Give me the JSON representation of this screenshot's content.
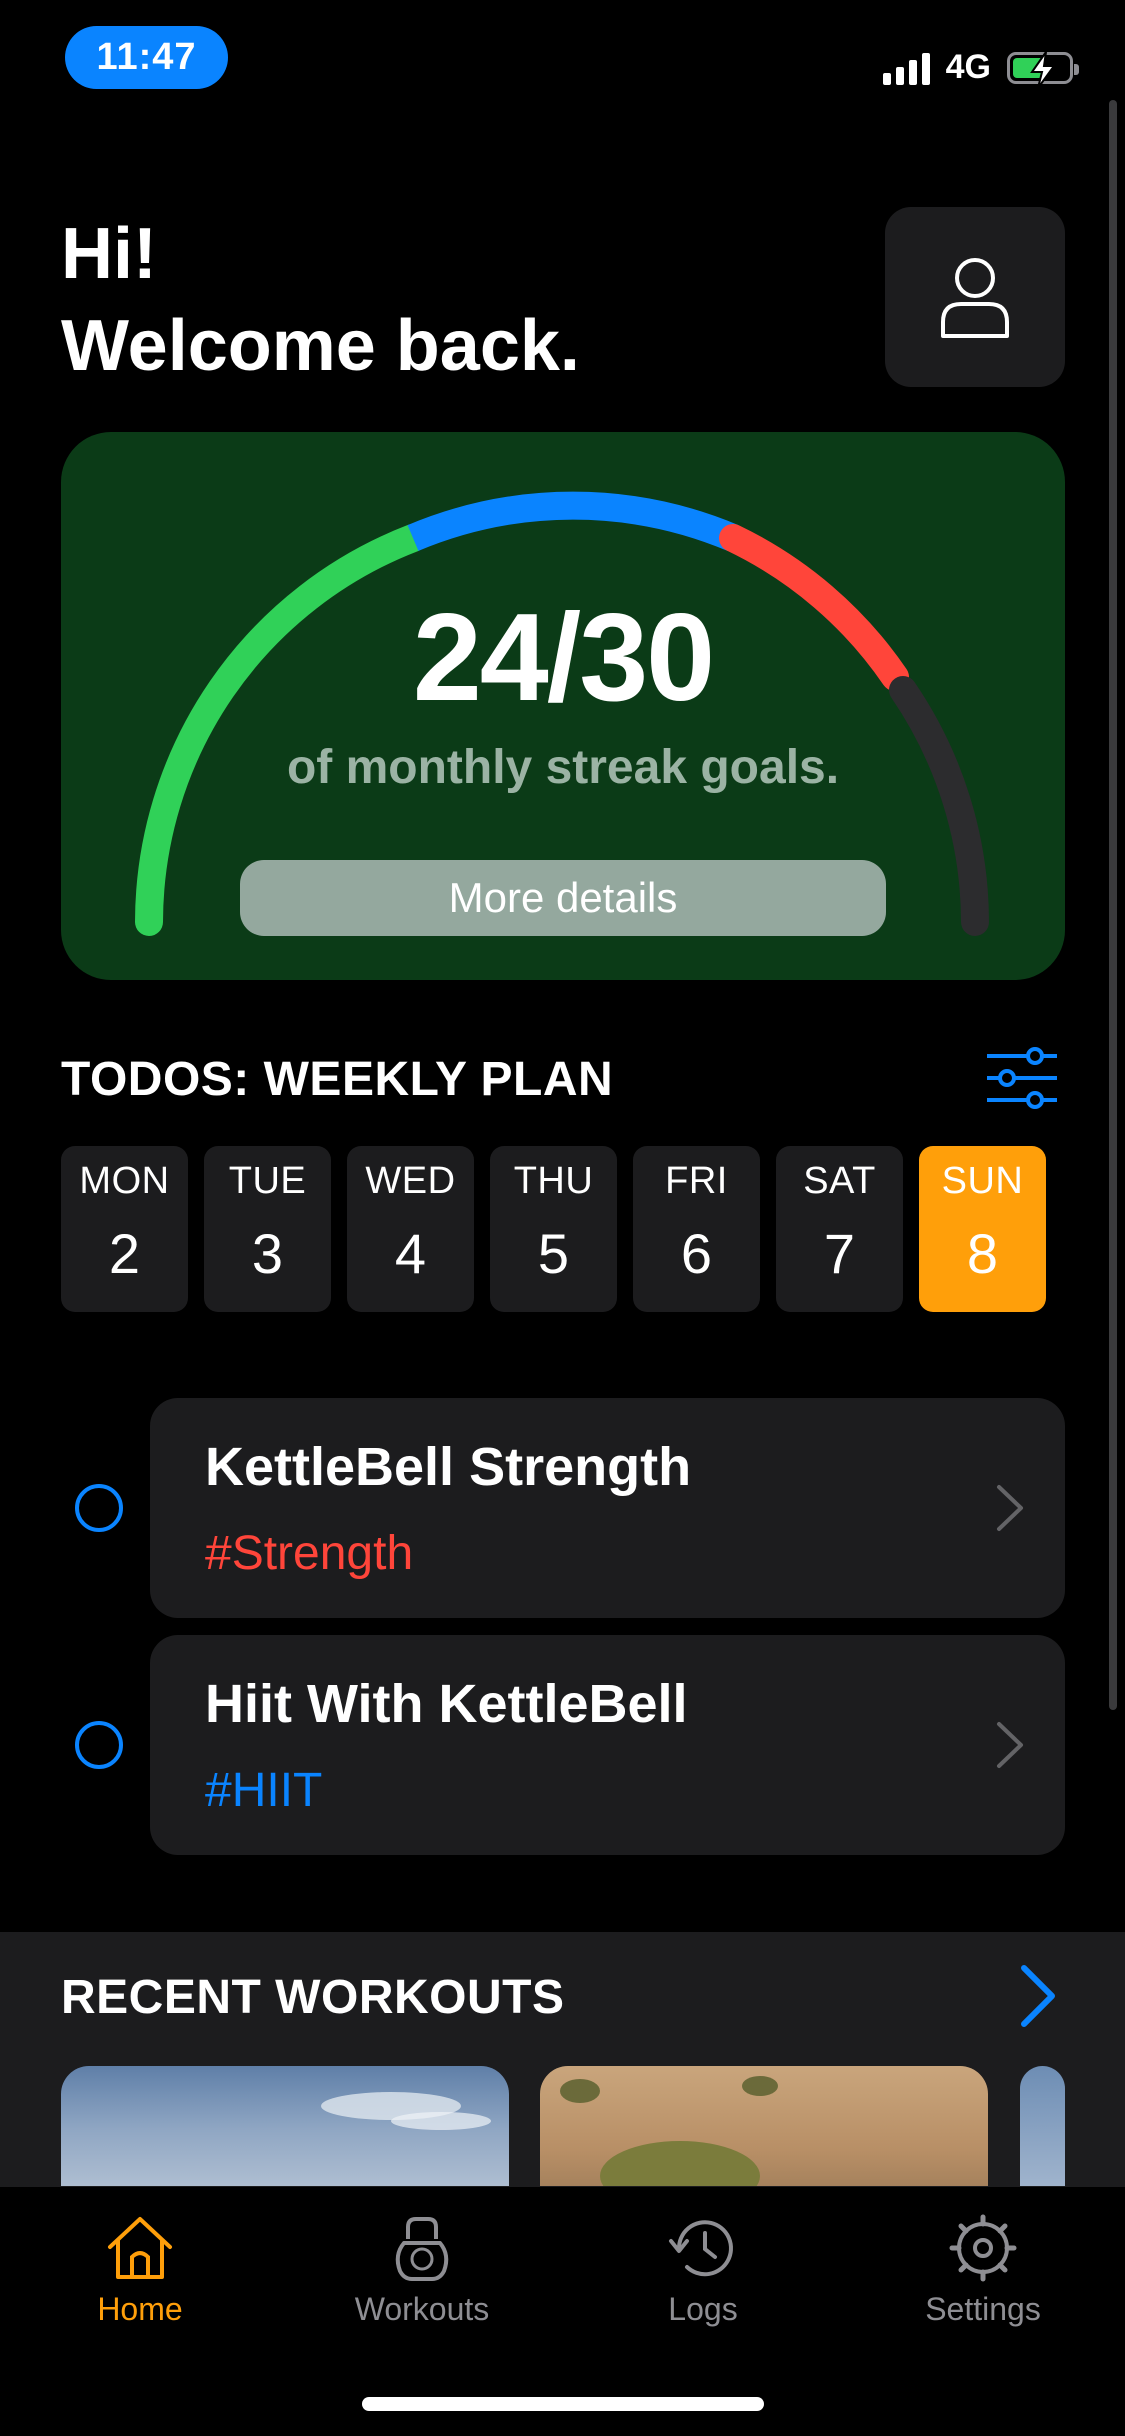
{
  "status_bar": {
    "time": "11:47",
    "network": "4G",
    "battery_level": 0.58,
    "battery_charging": true,
    "colors": {
      "time_pill": "#0a84ff",
      "battery": "#30d158"
    }
  },
  "header": {
    "greeting_line1": "Hi!",
    "greeting_line2": "Welcome back.",
    "profile_icon": "person-icon"
  },
  "streak": {
    "value": "24/30",
    "caption": "of monthly streak goals.",
    "button_label": "More details",
    "progress": 0.8,
    "segment_colors": [
      "#30d158",
      "#0a84ff",
      "#ff453a",
      "#3a3a3c"
    ]
  },
  "weekly_plan": {
    "title": "TODOS: WEEKLY PLAN",
    "filter_icon": "sliders-icon",
    "days": [
      {
        "name": "MON",
        "num": "2",
        "active": false
      },
      {
        "name": "TUE",
        "num": "3",
        "active": false
      },
      {
        "name": "WED",
        "num": "4",
        "active": false
      },
      {
        "name": "THU",
        "num": "5",
        "active": false
      },
      {
        "name": "FRI",
        "num": "6",
        "active": false
      },
      {
        "name": "SAT",
        "num": "7",
        "active": false
      },
      {
        "name": "SUN",
        "num": "8",
        "active": true
      }
    ],
    "active_color": "#ff9f0a"
  },
  "todos": [
    {
      "title": "KettleBell Strength",
      "tag": "#Strength",
      "tag_color": "#ff453a"
    },
    {
      "title": "Hiit With KettleBell",
      "tag": "#HIIT",
      "tag_color": "#0a84ff"
    }
  ],
  "recent_workouts": {
    "title": "RECENT WORKOUTS",
    "arrow_icon": "chevron-right-icon"
  },
  "tabbar": {
    "items": [
      {
        "label": "Home",
        "icon": "house-icon",
        "active": true
      },
      {
        "label": "Workouts",
        "icon": "kettlebell-icon",
        "active": false
      },
      {
        "label": "Logs",
        "icon": "history-icon",
        "active": false
      },
      {
        "label": "Settings",
        "icon": "gear-icon",
        "active": false
      }
    ],
    "active_color": "#ff9f0a"
  }
}
